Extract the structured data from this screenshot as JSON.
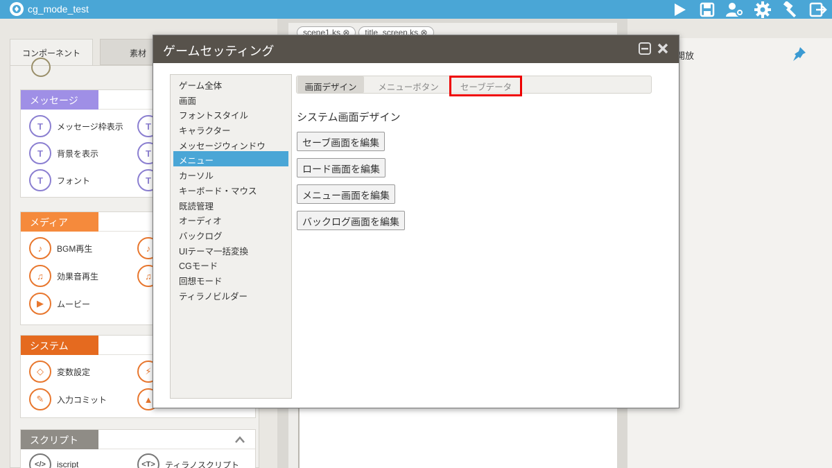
{
  "app": {
    "title": "cg_mode_test"
  },
  "toolbar": {
    "icons": [
      "play-icon",
      "save-icon",
      "users-gear-icon",
      "gear-icon",
      "hammer-icon",
      "export-icon"
    ]
  },
  "left_panel": {
    "tabs": [
      "コンポーネント",
      "素材"
    ],
    "sections": [
      {
        "label": "メッセージ",
        "color": "#9f8fe6",
        "items": [
          "メッセージ枠表示",
          "背景を表示",
          "フォント"
        ]
      },
      {
        "label": "メディア",
        "color": "#f58a3c",
        "items": [
          "BGM再生",
          "効果音再生",
          "ムービー"
        ]
      },
      {
        "label": "システム",
        "color": "#e56a1f",
        "items": [
          "変数設定",
          "入力コミット"
        ]
      },
      {
        "label": "スクリプト",
        "color": "#8f8c86",
        "items": [
          "iscript",
          "ティラノスクリプト"
        ]
      }
    ]
  },
  "editor": {
    "tabs": [
      "scene1.ks",
      "title_screen.ks"
    ]
  },
  "right_panel": {
    "title": "開放",
    "pin_icon": "pin-icon"
  },
  "modal": {
    "title": "ゲームセッティング",
    "menu": [
      "ゲーム全体",
      "画面",
      "フォントスタイル",
      "キャラクター",
      "メッセージウィンドウ",
      "メニュー",
      "カーソル",
      "キーボード・マウス",
      "既読管理",
      "オーディオ",
      "バックログ",
      "UIテーマ一括変換",
      "CGモード",
      "回想モード",
      "ティラノビルダー"
    ],
    "selected_index": 5,
    "tabs": [
      "画面デザイン",
      "メニューボタン",
      "セーブデータ"
    ],
    "section_title": "システム画面デザイン",
    "buttons": [
      "セーブ画面を編集",
      "ロード画面を編集",
      "メニュー画面を編集",
      "バックログ画面を編集"
    ]
  }
}
